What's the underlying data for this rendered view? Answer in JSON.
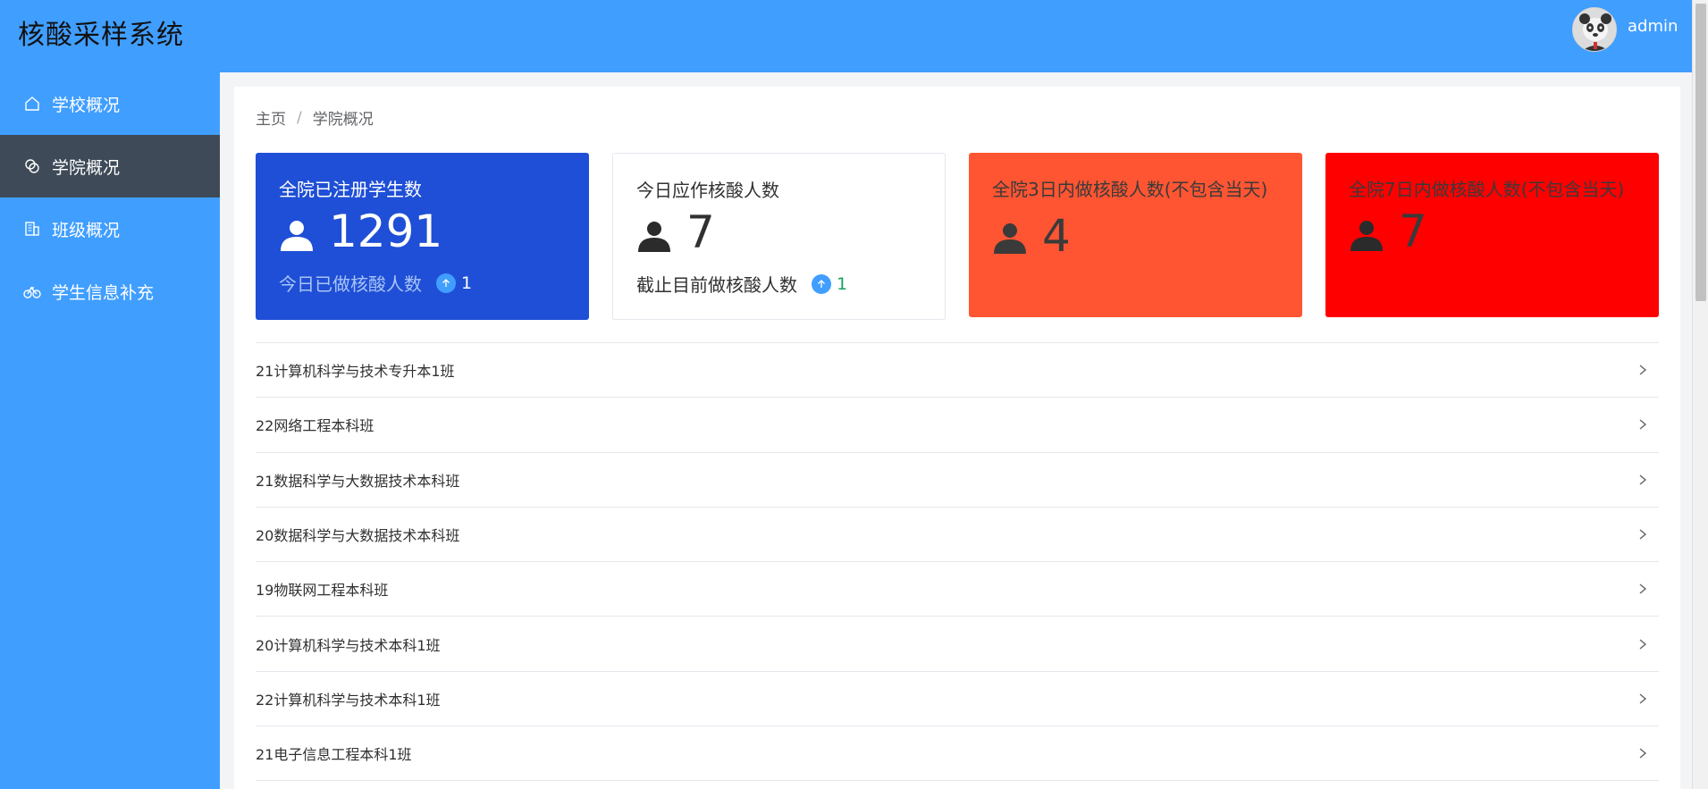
{
  "header": {
    "title": "核酸采样系统",
    "username": "admin"
  },
  "sidebar": {
    "items": [
      {
        "label": "学校概况",
        "icon": "home-icon",
        "active": false
      },
      {
        "label": "学院概况",
        "icon": "link-icon",
        "active": true
      },
      {
        "label": "班级概况",
        "icon": "office-building-icon",
        "active": false
      },
      {
        "label": "学生信息补充",
        "icon": "bicycle-icon",
        "active": false
      }
    ]
  },
  "breadcrumb": {
    "home": "主页",
    "separator": "/",
    "current": "学院概况"
  },
  "cards": [
    {
      "title": "全院已注册学生数",
      "value": "1291",
      "sub_label": "今日已做核酸人数",
      "sub_value": "1",
      "bg": "#1f4fd6",
      "text_color": "#ffffff"
    },
    {
      "title": "今日应作核酸人数",
      "value": "7",
      "sub_label": "截止目前做核酸人数",
      "sub_value": "1",
      "bg": "#ffffff",
      "text_color": "#303133"
    },
    {
      "title": "全院3日内做核酸人数(不包含当天)",
      "value": "4",
      "bg": "#ff5532",
      "text_color": "#3a3a3a"
    },
    {
      "title": "全院7日内做核酸人数(不包含当天)",
      "value": "7",
      "bg": "#ff0000",
      "text_color": "#3a3a3a"
    }
  ],
  "classes": [
    "21计算机科学与技术专升本1班",
    "22网络工程本科班",
    "21数据科学与大数据技术本科班",
    "20数据科学与大数据技术本科班",
    "19物联网工程本科班",
    "20计算机科学与技术本科1班",
    "22计算机科学与技术本科1班",
    "21电子信息工程本科1班"
  ],
  "colors": {
    "primary": "#409eff",
    "sidebar_active": "#3e4a57",
    "success": "#19a15f"
  }
}
